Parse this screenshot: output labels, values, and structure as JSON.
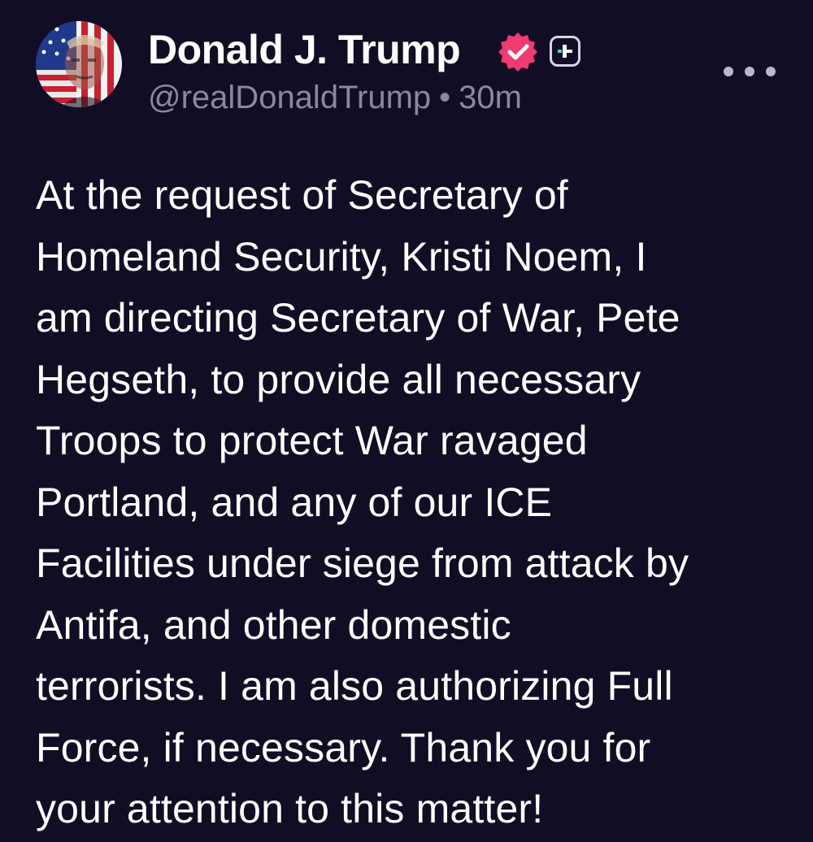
{
  "post": {
    "author": {
      "display_name": "Donald J. Trump",
      "handle": "@realDonaldTrump",
      "avatar_icon": "profile-avatar-flag",
      "verified_icon": "verified-badge-icon",
      "verified_color": "#f13a6f",
      "plus_icon": "plus-badge-icon",
      "plus_accent": "#3ed6c9"
    },
    "separator": "•",
    "time_ago": "30m",
    "more_icon": "more-options-icon",
    "body_lines": [
      "At the request of Secretary of",
      "Homeland Security, Kristi Noem, I",
      "am directing Secretary of War, Pete",
      "Hegseth, to provide all necessary",
      "Troops to protect War ravaged",
      "Portland, and any of our ICE",
      "Facilities under siege from attack by",
      "Antifa, and other domestic",
      "terrorists. I am also authorizing Full",
      "Force, if necessary. Thank you for",
      "your attention to this matter!"
    ]
  },
  "colors": {
    "background": "#100d24",
    "text": "#ffffff",
    "muted": "#8a87a0"
  }
}
